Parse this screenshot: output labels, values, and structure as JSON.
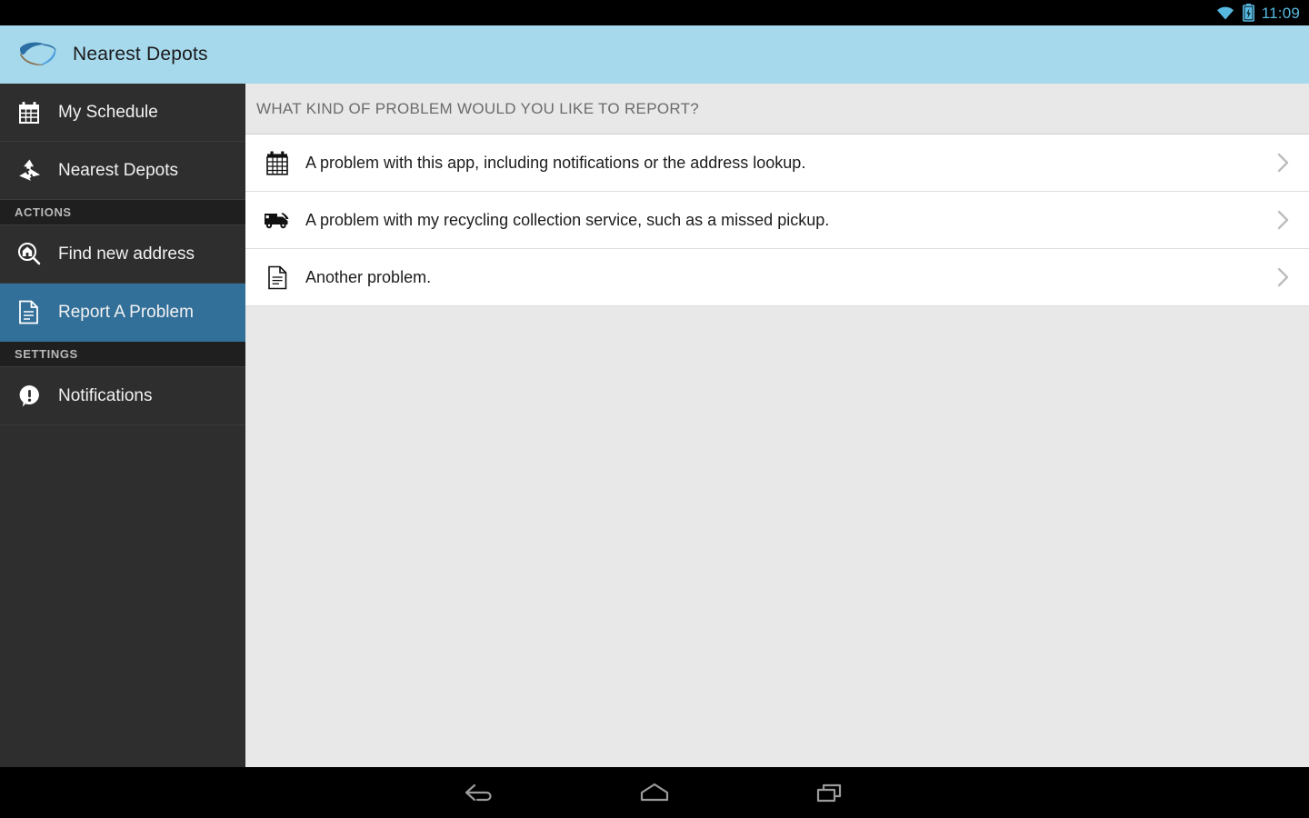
{
  "status_bar": {
    "time": "11:09",
    "wifi_icon": "wifi-icon",
    "battery_icon": "battery-charging-icon",
    "time_color": "#58b9e0"
  },
  "app_bar": {
    "title": "Nearest Depots",
    "logo_icon": "recycling-swirl-logo",
    "background_color": "#a6d9ec"
  },
  "sidebar": {
    "background_color": "#2e2e2e",
    "selected_color": "#337099",
    "entries": [
      {
        "type": "item",
        "label": "My Schedule",
        "icon": "calendar-icon",
        "selected": false
      },
      {
        "type": "item",
        "label": "Nearest Depots",
        "icon": "recycle-icon",
        "selected": false
      },
      {
        "type": "section",
        "label": "ACTIONS"
      },
      {
        "type": "item",
        "label": "Find new address",
        "icon": "search-home-icon",
        "selected": false
      },
      {
        "type": "item",
        "label": "Report A Problem",
        "icon": "document-icon",
        "selected": true
      },
      {
        "type": "section",
        "label": "SETTINGS"
      },
      {
        "type": "item",
        "label": "Notifications",
        "icon": "alert-bubble-icon",
        "selected": false
      }
    ]
  },
  "content": {
    "header": "WHAT KIND OF PROBLEM WOULD YOU LIKE TO REPORT?",
    "rows": [
      {
        "text": "A problem with this app, including notifications or the address lookup.",
        "icon": "calendar-icon",
        "chevron": "chevron-right-icon"
      },
      {
        "text": "A problem with my recycling collection service, such as a missed pickup.",
        "icon": "truck-icon",
        "chevron": "chevron-right-icon"
      },
      {
        "text": "Another problem.",
        "icon": "document-icon",
        "chevron": "chevron-right-icon"
      }
    ]
  },
  "nav_bar": {
    "buttons": [
      {
        "name": "back-button",
        "icon": "back-arrow-icon"
      },
      {
        "name": "home-button",
        "icon": "home-icon"
      },
      {
        "name": "recents-button",
        "icon": "recent-apps-icon"
      }
    ]
  }
}
